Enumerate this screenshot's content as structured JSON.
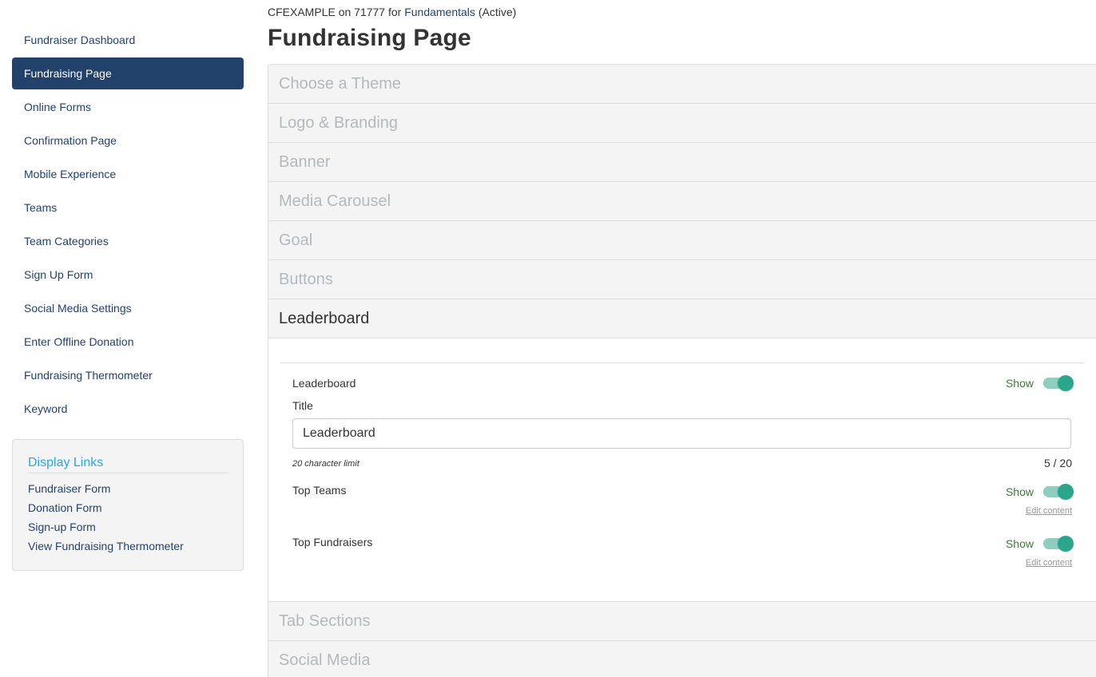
{
  "sidebar": {
    "items": [
      {
        "label": "Fundraiser Dashboard",
        "active": false
      },
      {
        "label": "Fundraising Page",
        "active": true
      },
      {
        "label": "Online Forms",
        "active": false
      },
      {
        "label": "Confirmation Page",
        "active": false
      },
      {
        "label": "Mobile Experience",
        "active": false
      },
      {
        "label": "Teams",
        "active": false
      },
      {
        "label": "Team Categories",
        "active": false
      },
      {
        "label": "Sign Up Form",
        "active": false
      },
      {
        "label": "Social Media Settings",
        "active": false
      },
      {
        "label": "Enter Offline Donation",
        "active": false
      },
      {
        "label": "Fundraising Thermometer",
        "active": false
      },
      {
        "label": "Keyword",
        "active": false
      }
    ]
  },
  "display_links": {
    "title": "Display Links",
    "links": [
      "Fundraiser Form",
      "Donation Form",
      "Sign-up Form",
      "View Fundraising Thermometer"
    ]
  },
  "header": {
    "account": "CFEXAMPLE on 71777 for",
    "campaign_link": "Fundamentals",
    "status": "(Active)",
    "title": "Fundraising Page"
  },
  "sections": {
    "choose_theme": "Choose a Theme",
    "logo_branding": "Logo & Branding",
    "banner": "Banner",
    "media_carousel": "Media Carousel",
    "goal": "Goal",
    "buttons": "Buttons",
    "leaderboard": "Leaderboard",
    "tab_sections": "Tab Sections",
    "social_media": "Social Media"
  },
  "leaderboard": {
    "toggle_label": "Leaderboard",
    "toggle_state": "Show",
    "title_label": "Title",
    "title_value": "Leaderboard",
    "hint": "20 character limit",
    "counter": "5 / 20",
    "top_teams": {
      "label": "Top Teams",
      "state": "Show",
      "edit": "Edit content"
    },
    "top_fundraisers": {
      "label": "Top Fundraisers",
      "state": "Show",
      "edit": "Edit content"
    }
  },
  "colors": {
    "nav_active_bg": "#23426b",
    "link": "#23426b",
    "display_links_title": "#29a8e0",
    "toggle_on": "#2aa68c",
    "show_label": "#3d7a3a"
  }
}
